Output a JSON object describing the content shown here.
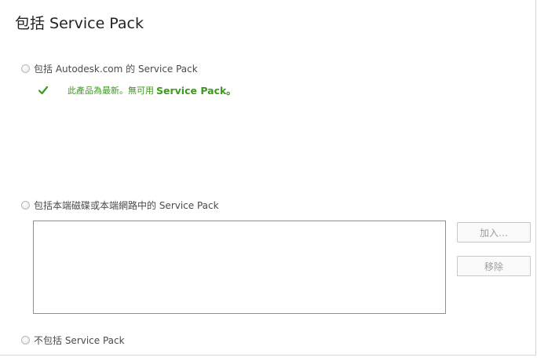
{
  "header": {
    "title": "包括 Service Pack"
  },
  "options": {
    "online": {
      "label": "包括 Autodesk.com 的 Service Pack",
      "status_icon": "check-icon",
      "status_text": "此產品為最新。無可用",
      "status_strong": "Service Pack。"
    },
    "local": {
      "label": "包括本端磁碟或本端網路中的 Service Pack",
      "list_items": []
    },
    "none": {
      "label": "不包括 Service Pack"
    }
  },
  "buttons": {
    "add_label": "加入…",
    "remove_label": "移除"
  },
  "colors": {
    "status_green": "#3c9a1e",
    "disabled_text": "#9c9c9c",
    "border": "#8f8f8f"
  }
}
